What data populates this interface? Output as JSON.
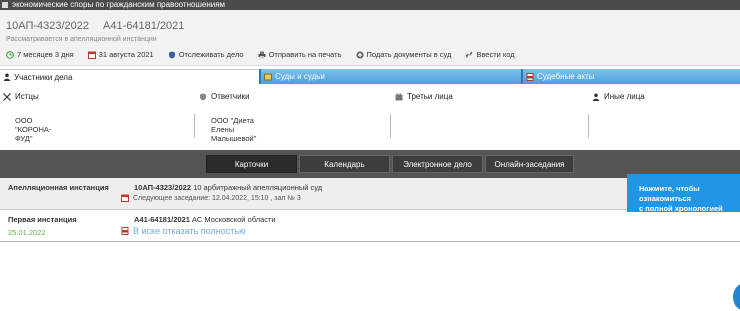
{
  "topbar": {
    "title": "экономические споры по гражданским правоотношениям"
  },
  "case": {
    "number_appeal": "10АП-4323/2022",
    "number_first": "А41-64181/2021",
    "status": "Рассматривается в апелляционной инстанции"
  },
  "actions": [
    {
      "icon": "clock-icon",
      "label": "7 месяцев 3 дня"
    },
    {
      "icon": "calendar-icon",
      "label": "31 августа 2021"
    },
    {
      "icon": "shield-icon",
      "label": "Отслеживать дело"
    },
    {
      "icon": "printer-icon",
      "label": "Отправить на печать"
    },
    {
      "icon": "plus-icon",
      "label": "Подать документы в суд"
    },
    {
      "icon": "link-icon",
      "label": "Ввести код"
    }
  ],
  "tabs": [
    {
      "label": "Участники дела"
    },
    {
      "label": "Суды и судьи"
    },
    {
      "label": "Судебные акты"
    }
  ],
  "parties": [
    {
      "title": "Истцы",
      "value": "ООО \"КОРОНА-ФУД\""
    },
    {
      "title": "Ответчики",
      "value": "ООО \"Диета Елены Малышевой\""
    },
    {
      "title": "Третьи лица",
      "value": ""
    },
    {
      "title": "Иные лица",
      "value": ""
    }
  ],
  "nav": [
    {
      "label": "Карточки",
      "active": true
    },
    {
      "label": "Календарь",
      "active": false
    },
    {
      "label": "Электронное дело",
      "active": false
    },
    {
      "label": "Онлайн-заседания",
      "active": false
    }
  ],
  "instances": {
    "appeal": {
      "label": "Апелляционная инстанция",
      "case": "10АП-4323/2022",
      "court": "10 арбитражный апелляционный суд",
      "next": "Следующее заседание: 12.04.2022, 15:10 , зал № 3"
    },
    "first": {
      "label": "Первая инстанция",
      "date": "25.01.2022",
      "case": "А41-64181/2021",
      "court": "АС Московской области",
      "decision": "В иске отказать полностью"
    }
  },
  "tooltip": {
    "line1": "Нажмите, чтобы ознакомиться",
    "line2": "с полной хронологией дела."
  },
  "colors": {
    "tab_blue": "#4aa0dc",
    "tooltip_blue": "#2196e6",
    "date_green": "#6aa84f",
    "link_blue": "#6fa8dc"
  }
}
